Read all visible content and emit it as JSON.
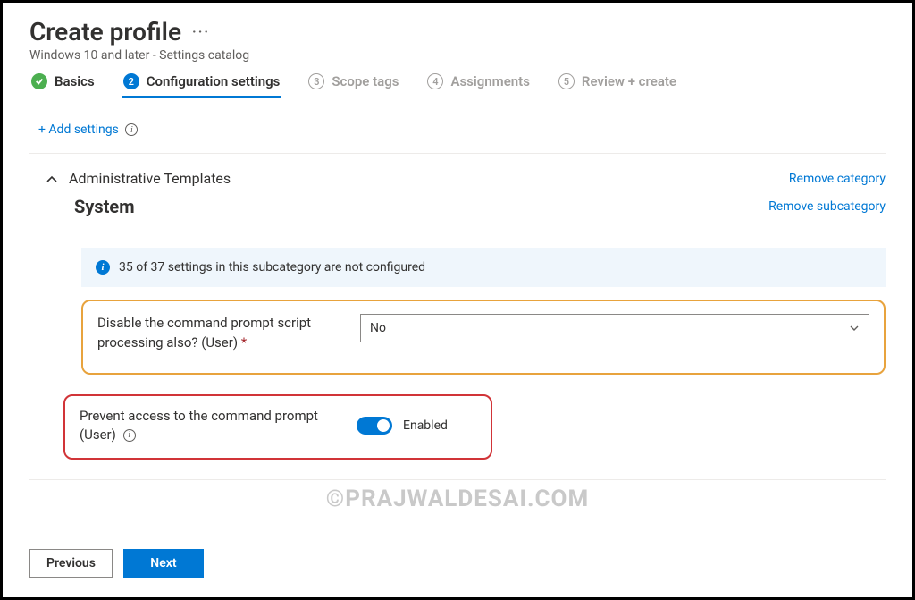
{
  "header": {
    "title": "Create profile",
    "subtitle": "Windows 10 and later - Settings catalog"
  },
  "steps": [
    {
      "label": "Basics",
      "num": "✓"
    },
    {
      "label": "Configuration settings",
      "num": "2"
    },
    {
      "label": "Scope tags",
      "num": "3"
    },
    {
      "label": "Assignments",
      "num": "4"
    },
    {
      "label": "Review + create",
      "num": "5"
    }
  ],
  "add_settings_label": "+ Add settings",
  "category": {
    "name": "Administrative Templates",
    "remove_label": "Remove category",
    "subcategory": "System",
    "remove_sub_label": "Remove subcategory"
  },
  "info_banner": "35 of 37 settings in this subcategory are not configured",
  "setting1": {
    "label": "Disable the command prompt script processing also? (User)",
    "selected": "No"
  },
  "setting2": {
    "label": "Prevent access to the command prompt (User)",
    "state": "Enabled"
  },
  "watermark": "©PRAJWALDESAI.COM",
  "footer": {
    "previous": "Previous",
    "next": "Next"
  }
}
